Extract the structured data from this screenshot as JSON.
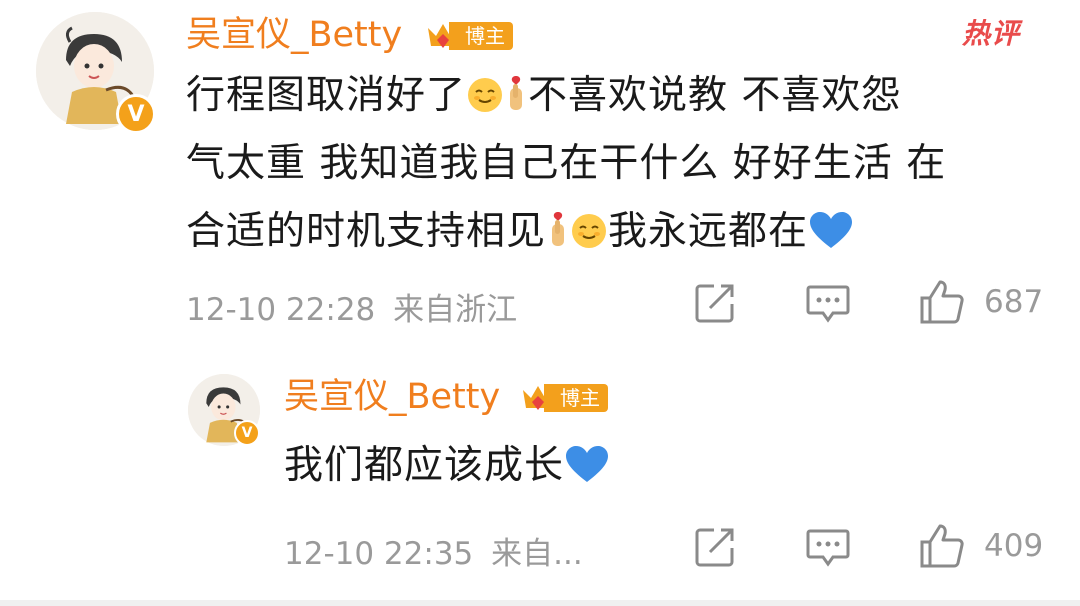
{
  "hot_tag": "热评",
  "comments": [
    {
      "username": "吴宣仪_Betty",
      "badge": "博主",
      "avatar_badge": "V",
      "text_parts": [
        "行程图取消好了",
        "不喜欢说教 不喜欢怨",
        "气太重 我知道我自己在干什么 好好生活 在",
        "合适的时机支持相见",
        "我永远都在"
      ],
      "timestamp": "12-10 22:28",
      "location": "来自浙江",
      "likes": "687"
    },
    {
      "username": "吴宣仪_Betty",
      "badge": "博主",
      "avatar_badge": "V",
      "text_parts": [
        "我们都应该成长"
      ],
      "timestamp": "12-10 22:35",
      "location": "来自...",
      "likes": "409"
    }
  ],
  "icons": {
    "share": "share-icon",
    "comment": "comment-icon",
    "like": "thumbs-up-icon",
    "heart": "blue-heart-emoji",
    "face": "smiling-face-emoji",
    "hand": "finger-heart-emoji"
  },
  "colors": {
    "username": "#f07e1e",
    "badge": "#f3a01c",
    "hot": "#e94b4b",
    "meta": "#9a9a9a",
    "text": "#1a1a1a",
    "heart": "#3d8ee6"
  }
}
